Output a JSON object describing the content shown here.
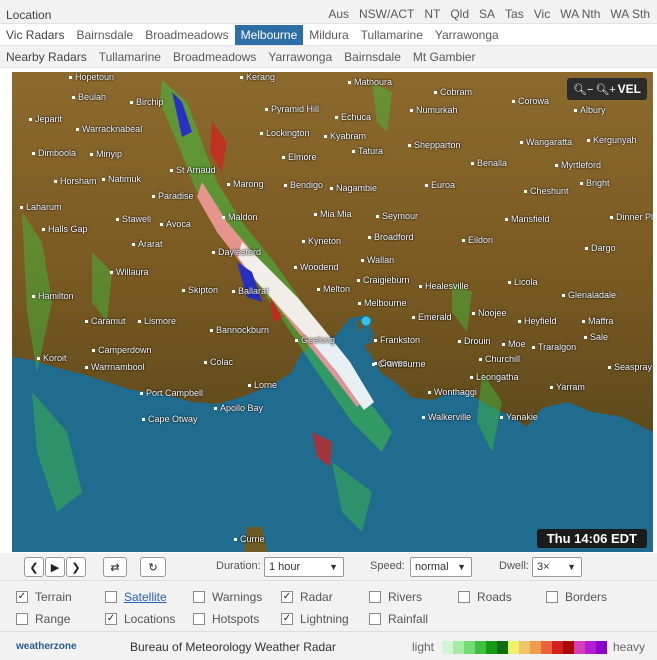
{
  "header": {
    "location_label": "Location",
    "states": [
      "Aus",
      "NSW/ACT",
      "NT",
      "Qld",
      "SA",
      "Tas",
      "Vic",
      "WA Nth",
      "WA Sth"
    ],
    "vic_label": "Vic Radars",
    "vic_radars": [
      "Bairnsdale",
      "Broadmeadows",
      "Melbourne",
      "Mildura",
      "Tullamarine",
      "Yarrawonga"
    ],
    "active_radar": "Melbourne",
    "nearby_label": "Nearby Radars",
    "nearby_radars": [
      "Tullamarine",
      "Broadmeadows",
      "Yarrawonga",
      "Bairnsdale",
      "Mt Gambier"
    ]
  },
  "map": {
    "places": [
      "Hopetoun",
      "Kerang",
      "Mathoura",
      "Cobram",
      "Beulah",
      "Birchip",
      "Pyramid Hill",
      "Numurkah",
      "Corowa",
      "Albury",
      "Jeparit",
      "Echuca",
      "Warracknabeal",
      "Lockington",
      "Kyabram",
      "Wangaratta",
      "Kergunyah",
      "Shepparton",
      "Dimboola",
      "Minyip",
      "Tatura",
      "Elmore",
      "Benalla",
      "Myrtleford",
      "Horsham",
      "St Arnaud",
      "Bendigo",
      "Nagambie",
      "Euroa",
      "Cheshunt",
      "Bright",
      "Natimuk",
      "Paradise",
      "Marong",
      "Laharum",
      "Halls Gap",
      "Stawell",
      "Avoca",
      "Maldon",
      "Mia Mia",
      "Seymour",
      "Mansfield",
      "Dinner Plain",
      "Ararat",
      "Kyneton",
      "Broadford",
      "Eildon",
      "Dargo",
      "Daylesford",
      "Woodend",
      "Wallan",
      "Licola",
      "Willaura",
      "Skipton",
      "Ballarat",
      "Craigieburn",
      "Healesville",
      "Glenaladale",
      "Hamilton",
      "Melton",
      "Melbourne",
      "Emerald",
      "Noojee",
      "Heyfield",
      "Maffra",
      "Caramut",
      "Lismore",
      "Bannockburn",
      "Geelong",
      "Frankston",
      "Drouin",
      "Moe",
      "Traralgon",
      "Sale",
      "Koroit",
      "Camperdown",
      "Colac",
      "Cranbourne",
      "Churchill",
      "Seaspray",
      "Warrnambool",
      "Lorne",
      "Cowes",
      "Leongatha",
      "Yarram",
      "Port Campbell",
      "Apollo Bay",
      "Wonthaggi",
      "Cape Otway",
      "Walkerville",
      "Yanakie",
      "Currie"
    ],
    "zoom_out_icon": "zoom-out-icon",
    "zoom_in_icon": "zoom-in-icon",
    "velocity_label": "VEL",
    "timestamp": "Thu 14:06 EDT"
  },
  "controls": {
    "duration_label": "Duration:",
    "duration_value": "1 hour",
    "speed_label": "Speed:",
    "speed_value": "normal",
    "dwell_label": "Dwell:",
    "dwell_value": "3×"
  },
  "layers": [
    {
      "label": "Terrain",
      "checked": true
    },
    {
      "label": "Satellite",
      "checked": false
    },
    {
      "label": "Warnings",
      "checked": false
    },
    {
      "label": "Radar",
      "checked": true
    },
    {
      "label": "Rivers",
      "checked": false
    },
    {
      "label": "Roads",
      "checked": false
    },
    {
      "label": "Borders",
      "checked": false
    },
    {
      "label": "Range",
      "checked": false
    },
    {
      "label": "Locations",
      "checked": true
    },
    {
      "label": "Hotspots",
      "checked": false
    },
    {
      "label": "Lightning",
      "checked": true
    },
    {
      "label": "Rainfall",
      "checked": false
    }
  ],
  "footer": {
    "logo": "weatherzone",
    "title": "Bureau of Meteorology Weather Radar",
    "legend_light": "light",
    "legend_heavy": "heavy",
    "legend_colors": [
      "#d4f5d4",
      "#a6eba6",
      "#74dc74",
      "#3fc03f",
      "#159b15",
      "#0b6d0b",
      "#f2f26a",
      "#f2c46a",
      "#f29a4c",
      "#e8643a",
      "#d41f1f",
      "#aa0707",
      "#d43fb7",
      "#b21cd4",
      "#8c00c8"
    ]
  }
}
